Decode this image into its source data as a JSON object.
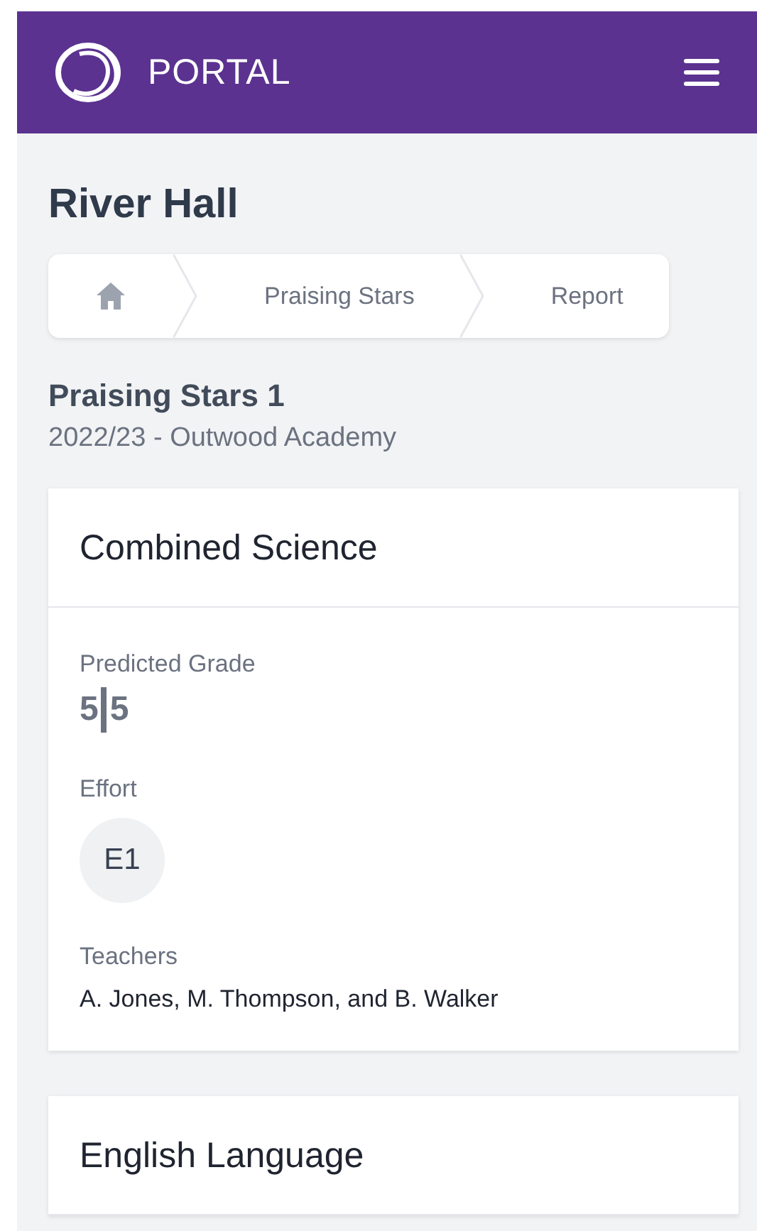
{
  "header": {
    "brand": "PORTAL"
  },
  "page_title": "River Hall",
  "breadcrumb": [
    {
      "kind": "home"
    },
    {
      "kind": "text",
      "label": "Praising Stars"
    },
    {
      "kind": "text",
      "label": "Report"
    }
  ],
  "report": {
    "title": "Praising Stars 1",
    "subtitle": "2022/23 - Outwood Academy"
  },
  "subjects": [
    {
      "name": "Combined Science",
      "grade_label": "Predicted Grade",
      "grades": [
        "5",
        "5"
      ],
      "effort_label": "Effort",
      "effort": "E1",
      "teachers_label": "Teachers",
      "teachers": "A. Jones, M. Thompson, and B. Walker"
    },
    {
      "name": "English Language"
    }
  ]
}
